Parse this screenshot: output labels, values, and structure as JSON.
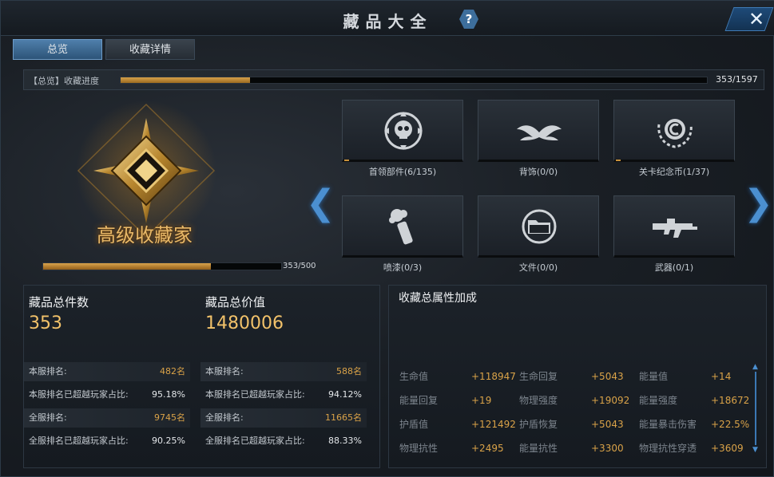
{
  "window": {
    "title": "藏品大全",
    "help": "?",
    "close": "✕"
  },
  "tabs": [
    {
      "label": "总览",
      "active": true
    },
    {
      "label": "收藏详情",
      "active": false
    }
  ],
  "overall_progress": {
    "label": "【总览】收藏进度",
    "current": 353,
    "total": 1597,
    "text": "353/1597",
    "fraction": 0.221
  },
  "rank": {
    "title": "高级收藏家",
    "text": "353/500",
    "fraction": 0.706
  },
  "categories": [
    {
      "label": "首领部件(6/135)",
      "icon": "skull-icon",
      "fraction": 0.044
    },
    {
      "label": "背饰(0/0)",
      "icon": "wings-icon",
      "fraction": 0
    },
    {
      "label": "关卡纪念币(1/37)",
      "icon": "coin-icon",
      "fraction": 0.027
    },
    {
      "label": "喷漆(0/3)",
      "icon": "spray-can-icon",
      "fraction": 0
    },
    {
      "label": "文件(0/0)",
      "icon": "folder-icon",
      "fraction": 0
    },
    {
      "label": "武器(0/1)",
      "icon": "rifle-icon",
      "fraction": 0
    }
  ],
  "stats": {
    "count": {
      "title": "藏品总件数",
      "value": "353",
      "rows": [
        {
          "k": "本服排名:",
          "v": "482名"
        },
        {
          "k": "本服排名已超越玩家占比:",
          "v": "95.18%"
        },
        {
          "k": "全服排名:",
          "v": "9745名"
        },
        {
          "k": "全服排名已超越玩家占比:",
          "v": "90.25%"
        }
      ]
    },
    "value": {
      "title": "藏品总价值",
      "value": "1480006",
      "rows": [
        {
          "k": "本服排名:",
          "v": "588名"
        },
        {
          "k": "本服排名已超越玩家占比:",
          "v": "94.12%"
        },
        {
          "k": "全服排名:",
          "v": "11665名"
        },
        {
          "k": "全服排名已超越玩家占比:",
          "v": "88.33%"
        }
      ]
    }
  },
  "attributes": {
    "title": "收藏总属性加成",
    "items": [
      {
        "n": "生命值",
        "v": "+118947"
      },
      {
        "n": "生命回复",
        "v": "+5043"
      },
      {
        "n": "能量值",
        "v": "+14"
      },
      {
        "n": "能量回复",
        "v": "+19"
      },
      {
        "n": "物理强度",
        "v": "+19092"
      },
      {
        "n": "能量强度",
        "v": "+18672"
      },
      {
        "n": "护盾值",
        "v": "+121492"
      },
      {
        "n": "护盾恢复",
        "v": "+5043"
      },
      {
        "n": "能量暴击伤害",
        "v": "+22.5%"
      },
      {
        "n": "物理抗性",
        "v": "+2495"
      },
      {
        "n": "能量抗性",
        "v": "+3300"
      },
      {
        "n": "物理抗性穿透",
        "v": "+3609"
      }
    ]
  },
  "nav": {
    "prev": "❮",
    "next": "❯"
  },
  "colors": {
    "accent": "#d9a248",
    "blue": "#4b8fd0",
    "gold_text": "#f2c26a"
  }
}
